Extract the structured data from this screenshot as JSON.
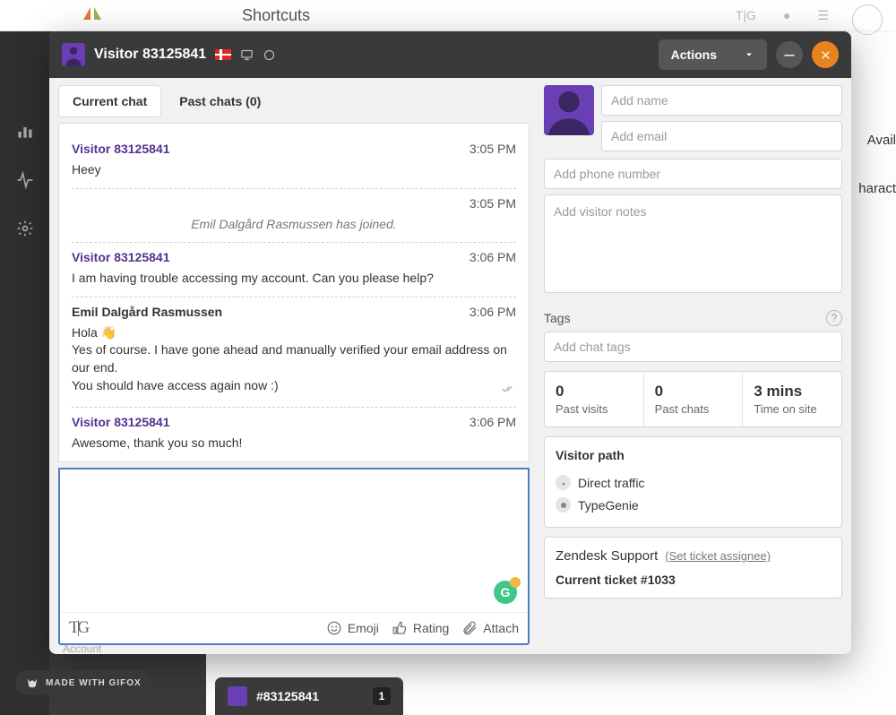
{
  "background": {
    "shortcuts_label": "Shortcuts",
    "availability_label": "Avail",
    "charact_label": "haract",
    "account_label": "Account"
  },
  "header": {
    "visitor_title": "Visitor 83125841",
    "actions_label": "Actions"
  },
  "tabs": {
    "current": "Current chat",
    "past": "Past chats (0)"
  },
  "messages": [
    {
      "type": "visitor",
      "sender": "Visitor 83125841",
      "time": "3:05 PM",
      "body": "Heey"
    },
    {
      "type": "system",
      "time": "3:05 PM",
      "body": "Emil Dalgård Rasmussen has joined."
    },
    {
      "type": "visitor",
      "sender": "Visitor 83125841",
      "time": "3:06 PM",
      "body": "I am having trouble accessing my account. Can you please help?"
    },
    {
      "type": "agent",
      "sender": "Emil Dalgård Rasmussen",
      "time": "3:06 PM",
      "lines": [
        "Hola 👋",
        "Yes of course. I have gone ahead and manually verified your email address on our end.",
        "You should have access again now :)"
      ],
      "read": true
    },
    {
      "type": "visitor",
      "sender": "Visitor 83125841",
      "time": "3:06 PM",
      "body": "Awesome, thank you so much!"
    }
  ],
  "composer": {
    "tg": "T|G",
    "emoji": "Emoji",
    "rating": "Rating",
    "attach": "Attach"
  },
  "profile": {
    "name_ph": "Add name",
    "email_ph": "Add email",
    "phone_ph": "Add phone number",
    "notes_ph": "Add visitor notes"
  },
  "tags": {
    "label": "Tags",
    "placeholder": "Add chat tags"
  },
  "stats": {
    "visits_val": "0",
    "visits_lbl": "Past visits",
    "chats_val": "0",
    "chats_lbl": "Past chats",
    "time_val": "3 mins",
    "time_lbl": "Time on site"
  },
  "visitor_path": {
    "title": "Visitor path",
    "items": [
      "Direct traffic",
      "TypeGenie"
    ]
  },
  "zendesk": {
    "title": "Zendesk Support",
    "assign": "(Set ticket assignee)",
    "ticket": "Current ticket #1033"
  },
  "bottom_tab": {
    "label": "#83125841",
    "badge": "1"
  },
  "gifox": "MADE WITH GIFOX"
}
